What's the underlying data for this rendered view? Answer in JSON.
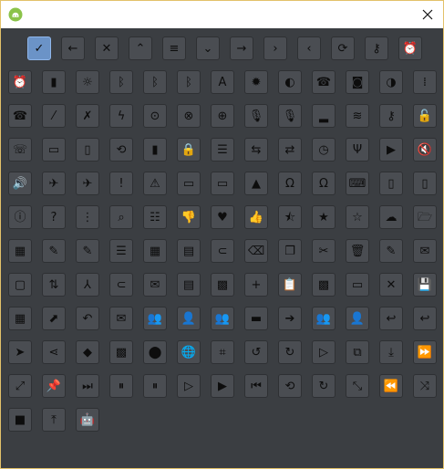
{
  "window": {
    "app_icon": "android-robot-icon",
    "close_icon": "close-icon",
    "accent_border": "#e3c26a",
    "background": "#3b3e42"
  },
  "icons": [
    {
      "name": "checkmark-icon",
      "glyph": "✓"
    },
    {
      "name": "arrow-left-icon",
      "glyph": "←"
    },
    {
      "name": "close-x-icon",
      "glyph": "✕"
    },
    {
      "name": "chevron-up-icon",
      "glyph": "⌃"
    },
    {
      "name": "menu-icon",
      "glyph": "≡"
    },
    {
      "name": "chevron-down-icon",
      "glyph": "⌄"
    },
    {
      "name": "arrow-right-icon",
      "glyph": "→"
    },
    {
      "name": "chevron-right-icon",
      "glyph": "›"
    },
    {
      "name": "chevron-left-icon",
      "glyph": "‹"
    },
    {
      "name": "refresh-icon",
      "glyph": "⟳"
    },
    {
      "name": "key-icon",
      "glyph": "⚷"
    },
    {
      "name": "alarm-add-icon",
      "glyph": "⏰"
    },
    {
      "name": "alarm-icon",
      "glyph": "⏰"
    },
    {
      "name": "battery-icon",
      "glyph": "▮"
    },
    {
      "name": "brightness-icon",
      "glyph": "☼"
    },
    {
      "name": "bluetooth-connected-icon",
      "glyph": "ᛒ"
    },
    {
      "name": "bluetooth-searching-icon",
      "glyph": "ᛒ"
    },
    {
      "name": "bluetooth-icon",
      "glyph": "ᛒ"
    },
    {
      "name": "brightness-auto-icon",
      "glyph": "A"
    },
    {
      "name": "brightness-high-icon",
      "glyph": "✹"
    },
    {
      "name": "brightness-medium-icon",
      "glyph": "◐"
    },
    {
      "name": "phone-icon",
      "glyph": "☎"
    },
    {
      "name": "camera-icon",
      "glyph": "◙"
    },
    {
      "name": "contrast-icon",
      "glyph": "◑"
    },
    {
      "name": "dialpad-icon",
      "glyph": "⁞"
    },
    {
      "name": "call-end-icon",
      "glyph": "☎"
    },
    {
      "name": "signal-off-icon",
      "glyph": "⁄"
    },
    {
      "name": "signal-cellular-off-icon",
      "glyph": "✗"
    },
    {
      "name": "flash-icon",
      "glyph": "ϟ"
    },
    {
      "name": "gps-fixed-icon",
      "glyph": "⊙"
    },
    {
      "name": "gps-off-icon",
      "glyph": "⊗"
    },
    {
      "name": "gps-not-fixed-icon",
      "glyph": "⊕"
    },
    {
      "name": "mic-off-icon",
      "glyph": "🎙"
    },
    {
      "name": "mic-icon",
      "glyph": "🎙"
    },
    {
      "name": "signal-bars-icon",
      "glyph": "▂"
    },
    {
      "name": "wifi-icon",
      "glyph": "≋"
    },
    {
      "name": "vpn-key-icon",
      "glyph": "⚷"
    },
    {
      "name": "lock-open-icon",
      "glyph": "🔓"
    },
    {
      "name": "phone-in-talk-icon",
      "glyph": "☏"
    },
    {
      "name": "screen-lock-landscape-icon",
      "glyph": "▭"
    },
    {
      "name": "screen-lock-portrait-icon",
      "glyph": "▯"
    },
    {
      "name": "screen-rotation-icon",
      "glyph": "⟲"
    },
    {
      "name": "sd-card-icon",
      "glyph": "▮"
    },
    {
      "name": "lock-icon",
      "glyph": "🔒"
    },
    {
      "name": "storage-icon",
      "glyph": "☰"
    },
    {
      "name": "switch-camera-icon",
      "glyph": "⇆"
    },
    {
      "name": "switch-video-icon",
      "glyph": "⇄"
    },
    {
      "name": "clock-icon",
      "glyph": "◷"
    },
    {
      "name": "usb-icon",
      "glyph": "Ψ"
    },
    {
      "name": "videocam-icon",
      "glyph": "▶"
    },
    {
      "name": "volume-off-icon",
      "glyph": "🔇"
    },
    {
      "name": "volume-up-icon",
      "glyph": "🔊"
    },
    {
      "name": "airplane-icon",
      "glyph": "✈"
    },
    {
      "name": "airplane-mode-icon",
      "glyph": "✈"
    },
    {
      "name": "error-icon",
      "glyph": "!"
    },
    {
      "name": "warning-icon",
      "glyph": "⚠"
    },
    {
      "name": "laptop-icon",
      "glyph": "▭"
    },
    {
      "name": "desktop-icon",
      "glyph": "▭"
    },
    {
      "name": "dock-icon",
      "glyph": "▲"
    },
    {
      "name": "headset-icon",
      "glyph": "Ω"
    },
    {
      "name": "headset-mic-icon",
      "glyph": "Ω"
    },
    {
      "name": "keyboard-icon",
      "glyph": "⌨"
    },
    {
      "name": "mouse-icon",
      "glyph": "▯"
    },
    {
      "name": "phone-android-icon",
      "glyph": "▯"
    },
    {
      "name": "info-icon",
      "glyph": "ⓘ"
    },
    {
      "name": "help-icon",
      "glyph": "?"
    },
    {
      "name": "overflow-icon",
      "glyph": "⋮"
    },
    {
      "name": "search-icon",
      "glyph": "⌕"
    },
    {
      "name": "tune-icon",
      "glyph": "☷"
    },
    {
      "name": "thumb-down-icon",
      "glyph": "👎"
    },
    {
      "name": "heart-icon",
      "glyph": "♥"
    },
    {
      "name": "thumb-up-icon",
      "glyph": "👍"
    },
    {
      "name": "star-half-icon",
      "glyph": "⯪"
    },
    {
      "name": "star-icon",
      "glyph": "★"
    },
    {
      "name": "star-outline-icon",
      "glyph": "☆"
    },
    {
      "name": "cloud-icon",
      "glyph": "☁"
    },
    {
      "name": "folder-open-icon",
      "glyph": "🗁"
    },
    {
      "name": "calendar-grid-icon",
      "glyph": "▦"
    },
    {
      "name": "edit-icon",
      "glyph": "✎"
    },
    {
      "name": "edit-add-icon",
      "glyph": "✎"
    },
    {
      "name": "sort-icon",
      "glyph": "☰"
    },
    {
      "name": "view-module-icon",
      "glyph": "▦"
    },
    {
      "name": "document-icon",
      "glyph": "▤"
    },
    {
      "name": "attachment-icon",
      "glyph": "⊂"
    },
    {
      "name": "backspace-icon",
      "glyph": "⌫"
    },
    {
      "name": "copy-icon",
      "glyph": "❐"
    },
    {
      "name": "cut-icon",
      "glyph": "✂"
    },
    {
      "name": "delete-icon",
      "glyph": "🗑"
    },
    {
      "name": "pencil-icon",
      "glyph": "✎"
    },
    {
      "name": "email-icon",
      "glyph": "✉"
    },
    {
      "name": "event-icon",
      "glyph": "▢"
    },
    {
      "name": "import-export-icon",
      "glyph": "⇅"
    },
    {
      "name": "merge-icon",
      "glyph": "⅄"
    },
    {
      "name": "attach-add-icon",
      "glyph": "⊂"
    },
    {
      "name": "add-email-icon",
      "glyph": "✉"
    },
    {
      "name": "add-note-icon",
      "glyph": "▤"
    },
    {
      "name": "add-photo-icon",
      "glyph": "▩"
    },
    {
      "name": "add-icon",
      "glyph": "+"
    },
    {
      "name": "clipboard-icon",
      "glyph": "📋"
    },
    {
      "name": "image-icon",
      "glyph": "▩"
    },
    {
      "name": "briefcase-icon",
      "glyph": "▭"
    },
    {
      "name": "cancel-icon",
      "glyph": "✕"
    },
    {
      "name": "save-icon",
      "glyph": "💾"
    },
    {
      "name": "apps-icon",
      "glyph": "▦"
    },
    {
      "name": "navigation-icon",
      "glyph": "⬈"
    },
    {
      "name": "undo-icon",
      "glyph": "↶"
    },
    {
      "name": "drafts-icon",
      "glyph": "✉"
    },
    {
      "name": "group-add-icon",
      "glyph": "👥"
    },
    {
      "name": "person-add-icon",
      "glyph": "👤"
    },
    {
      "name": "group-icon",
      "glyph": "👥"
    },
    {
      "name": "label-icon",
      "glyph": "▬"
    },
    {
      "name": "forward-icon",
      "glyph": "➔"
    },
    {
      "name": "supervisor-account-icon",
      "glyph": "👥"
    },
    {
      "name": "account-icon",
      "glyph": "👤"
    },
    {
      "name": "reply-all-icon",
      "glyph": "↩"
    },
    {
      "name": "reply-icon",
      "glyph": "↩"
    },
    {
      "name": "send-icon",
      "glyph": "➤"
    },
    {
      "name": "share-icon",
      "glyph": "⋖"
    },
    {
      "name": "directions-icon",
      "glyph": "◆"
    },
    {
      "name": "map-icon",
      "glyph": "▩"
    },
    {
      "name": "place-icon",
      "glyph": "⬤"
    },
    {
      "name": "public-icon",
      "glyph": "🌐"
    },
    {
      "name": "crop-icon",
      "glyph": "⌗"
    },
    {
      "name": "replay-icon",
      "glyph": "↺"
    },
    {
      "name": "replay-alt-icon",
      "glyph": "↻"
    },
    {
      "name": "play-box-icon",
      "glyph": "▷"
    },
    {
      "name": "library-add-icon",
      "glyph": "⧉"
    },
    {
      "name": "download-icon",
      "glyph": "⤓"
    },
    {
      "name": "fast-forward-icon",
      "glyph": "⏩"
    },
    {
      "name": "fullscreen-icon",
      "glyph": "⤢"
    },
    {
      "name": "pin-icon",
      "glyph": "📌"
    },
    {
      "name": "skip-next-icon",
      "glyph": "⏭"
    },
    {
      "name": "pause-circle-icon",
      "glyph": "⏸"
    },
    {
      "name": "pause-icon",
      "glyph": "⏸"
    },
    {
      "name": "play-circle-icon",
      "glyph": "▷"
    },
    {
      "name": "play-icon",
      "glyph": "▶"
    },
    {
      "name": "skip-previous-icon",
      "glyph": "⏮"
    },
    {
      "name": "repeat-icon",
      "glyph": "⟲"
    },
    {
      "name": "replay-arrow-icon",
      "glyph": "↻"
    },
    {
      "name": "fullscreen-exit-icon",
      "glyph": "⤡"
    },
    {
      "name": "rewind-icon",
      "glyph": "⏪"
    },
    {
      "name": "shuffle-icon",
      "glyph": "⤨"
    },
    {
      "name": "stop-icon",
      "glyph": "■"
    },
    {
      "name": "upload-icon",
      "glyph": "⤒"
    },
    {
      "name": "android-icon",
      "glyph": "🤖"
    }
  ]
}
